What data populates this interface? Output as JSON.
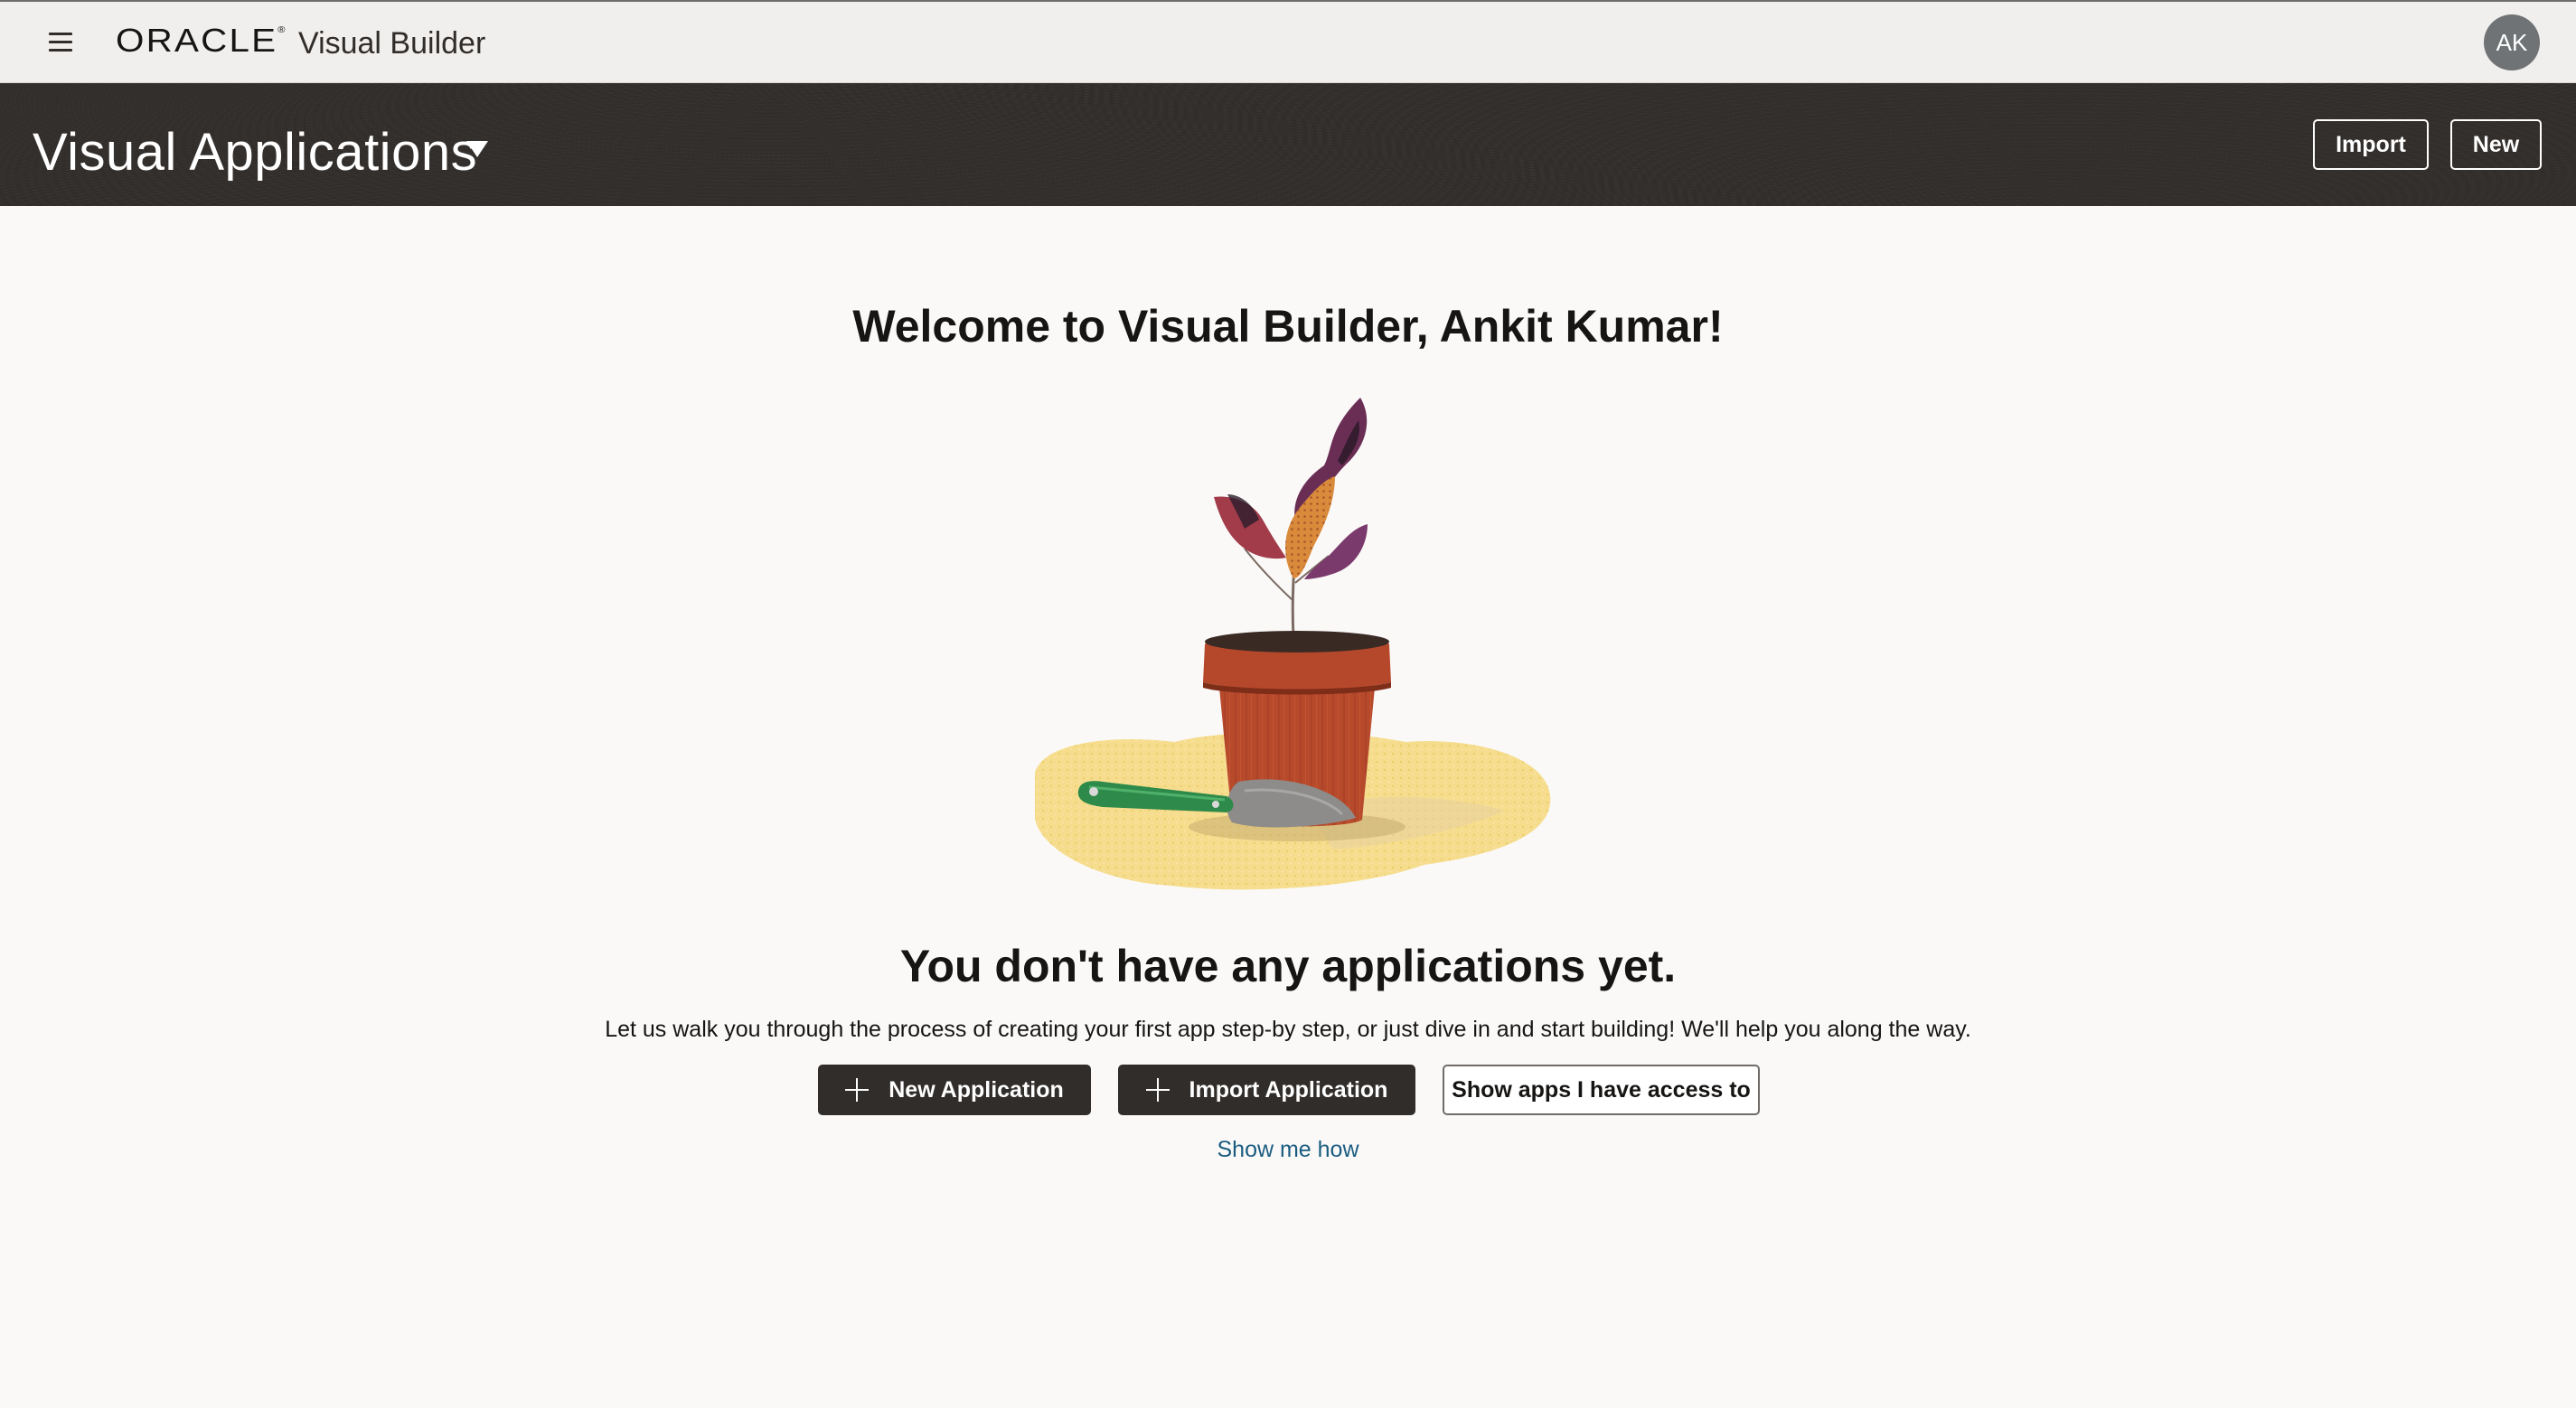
{
  "brand": {
    "logo_text": "ORACLE",
    "logo_mark": "®",
    "product_name": "Visual Builder",
    "menu_icon": "hamburger-menu-icon",
    "user_initials": "AK"
  },
  "header": {
    "title": "Visual Applications",
    "title_dropdown_icon": "caret-down-icon",
    "import_label": "Import",
    "new_label": "New"
  },
  "main": {
    "welcome": "Welcome to Visual Builder, Ankit Kumar!",
    "illustration": "potted-plant-illustration",
    "empty_heading": "You don't have any applications yet.",
    "empty_description": "Let us walk you through the process of creating your first app step-by step, or just dive in and start building! We'll help you along the way.",
    "buttons": {
      "new_application": "New Application",
      "import_application": "Import Application",
      "show_apps": "Show apps I have access to"
    },
    "show_me_how": "Show me how"
  },
  "colors": {
    "header_band": "#312d2a",
    "brand_bar": "#f1efed",
    "page_background": "#faf9f8",
    "link": "#1a5c80",
    "avatar": "#6f7375"
  }
}
